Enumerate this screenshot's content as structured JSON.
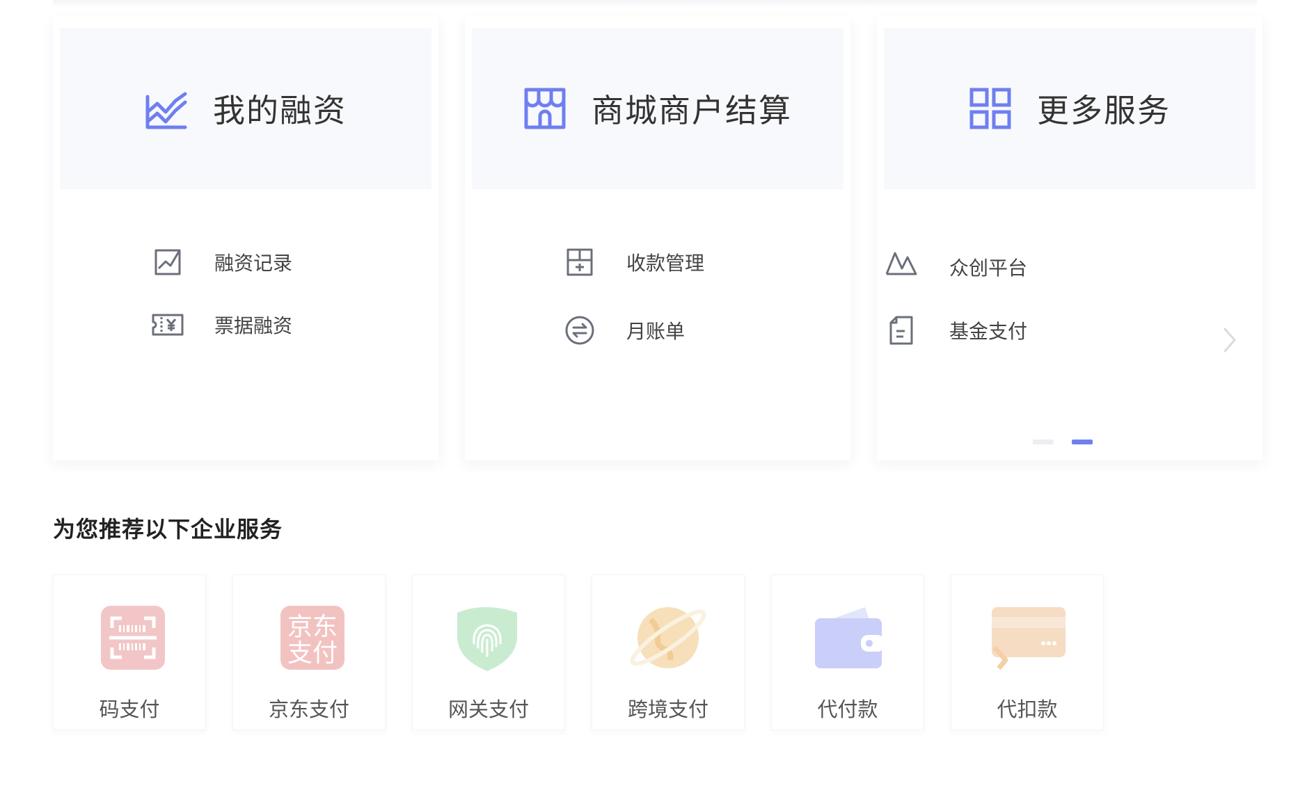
{
  "cards": [
    {
      "title": "我的融资",
      "icon": "trend-chart-icon",
      "links": [
        {
          "label": "融资记录",
          "icon": "trend-up-box-icon"
        },
        {
          "label": "票据融资",
          "icon": "ticket-yen-icon"
        }
      ]
    },
    {
      "title": "商城商户结算",
      "icon": "store-icon",
      "links": [
        {
          "label": "收款管理",
          "icon": "cash-register-icon"
        },
        {
          "label": "月账单",
          "icon": "exchange-circle-icon"
        }
      ]
    },
    {
      "title": "更多服务",
      "icon": "grid-icon",
      "links": [
        {
          "label": "众创平台",
          "icon": "mountain-icon"
        },
        {
          "label": "基金支付",
          "icon": "document-icon"
        }
      ],
      "pagination": {
        "total": 2,
        "active": 2
      }
    }
  ],
  "recommend": {
    "title": "为您推荐以下企业服务",
    "services": [
      {
        "label": "码支付",
        "icon": "barcode-scan-icon"
      },
      {
        "label": "京东支付",
        "icon": "jd-pay-icon",
        "icon_text_1": "京东",
        "icon_text_2": "支付"
      },
      {
        "label": "网关支付",
        "icon": "fingerprint-shield-icon"
      },
      {
        "label": "跨境支付",
        "icon": "planet-icon"
      },
      {
        "label": "代付款",
        "icon": "wallet-icon"
      },
      {
        "label": "代扣款",
        "icon": "card-debit-icon"
      }
    ]
  },
  "colors": {
    "accent": "#6f7ff0",
    "icon_gray": "#6b6f7b",
    "header_bg": "#f8f9fc"
  }
}
